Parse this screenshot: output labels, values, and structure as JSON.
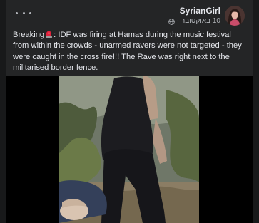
{
  "post": {
    "author": "SyrianGirl",
    "timestamp": "10 באוקטובר",
    "meta_separator": "·",
    "text_before_emoji": "Breaking",
    "text_after_emoji": ": IDF was firing at Hamas during the music festival from within the crowds - unarmed ravers were not targeted - they were caught in the cross fire!!! The Rave was right next to the militarised border fence."
  },
  "icons": {
    "more": "more-options-icon",
    "privacy": "globe-icon",
    "emoji": "police-light-emoji-icon"
  },
  "colors": {
    "page_background": "#18191a",
    "card_background": "#242526",
    "primary_text": "#e4e6eb",
    "secondary_text": "#b0b3b8",
    "video_letterbox": "#000000"
  }
}
